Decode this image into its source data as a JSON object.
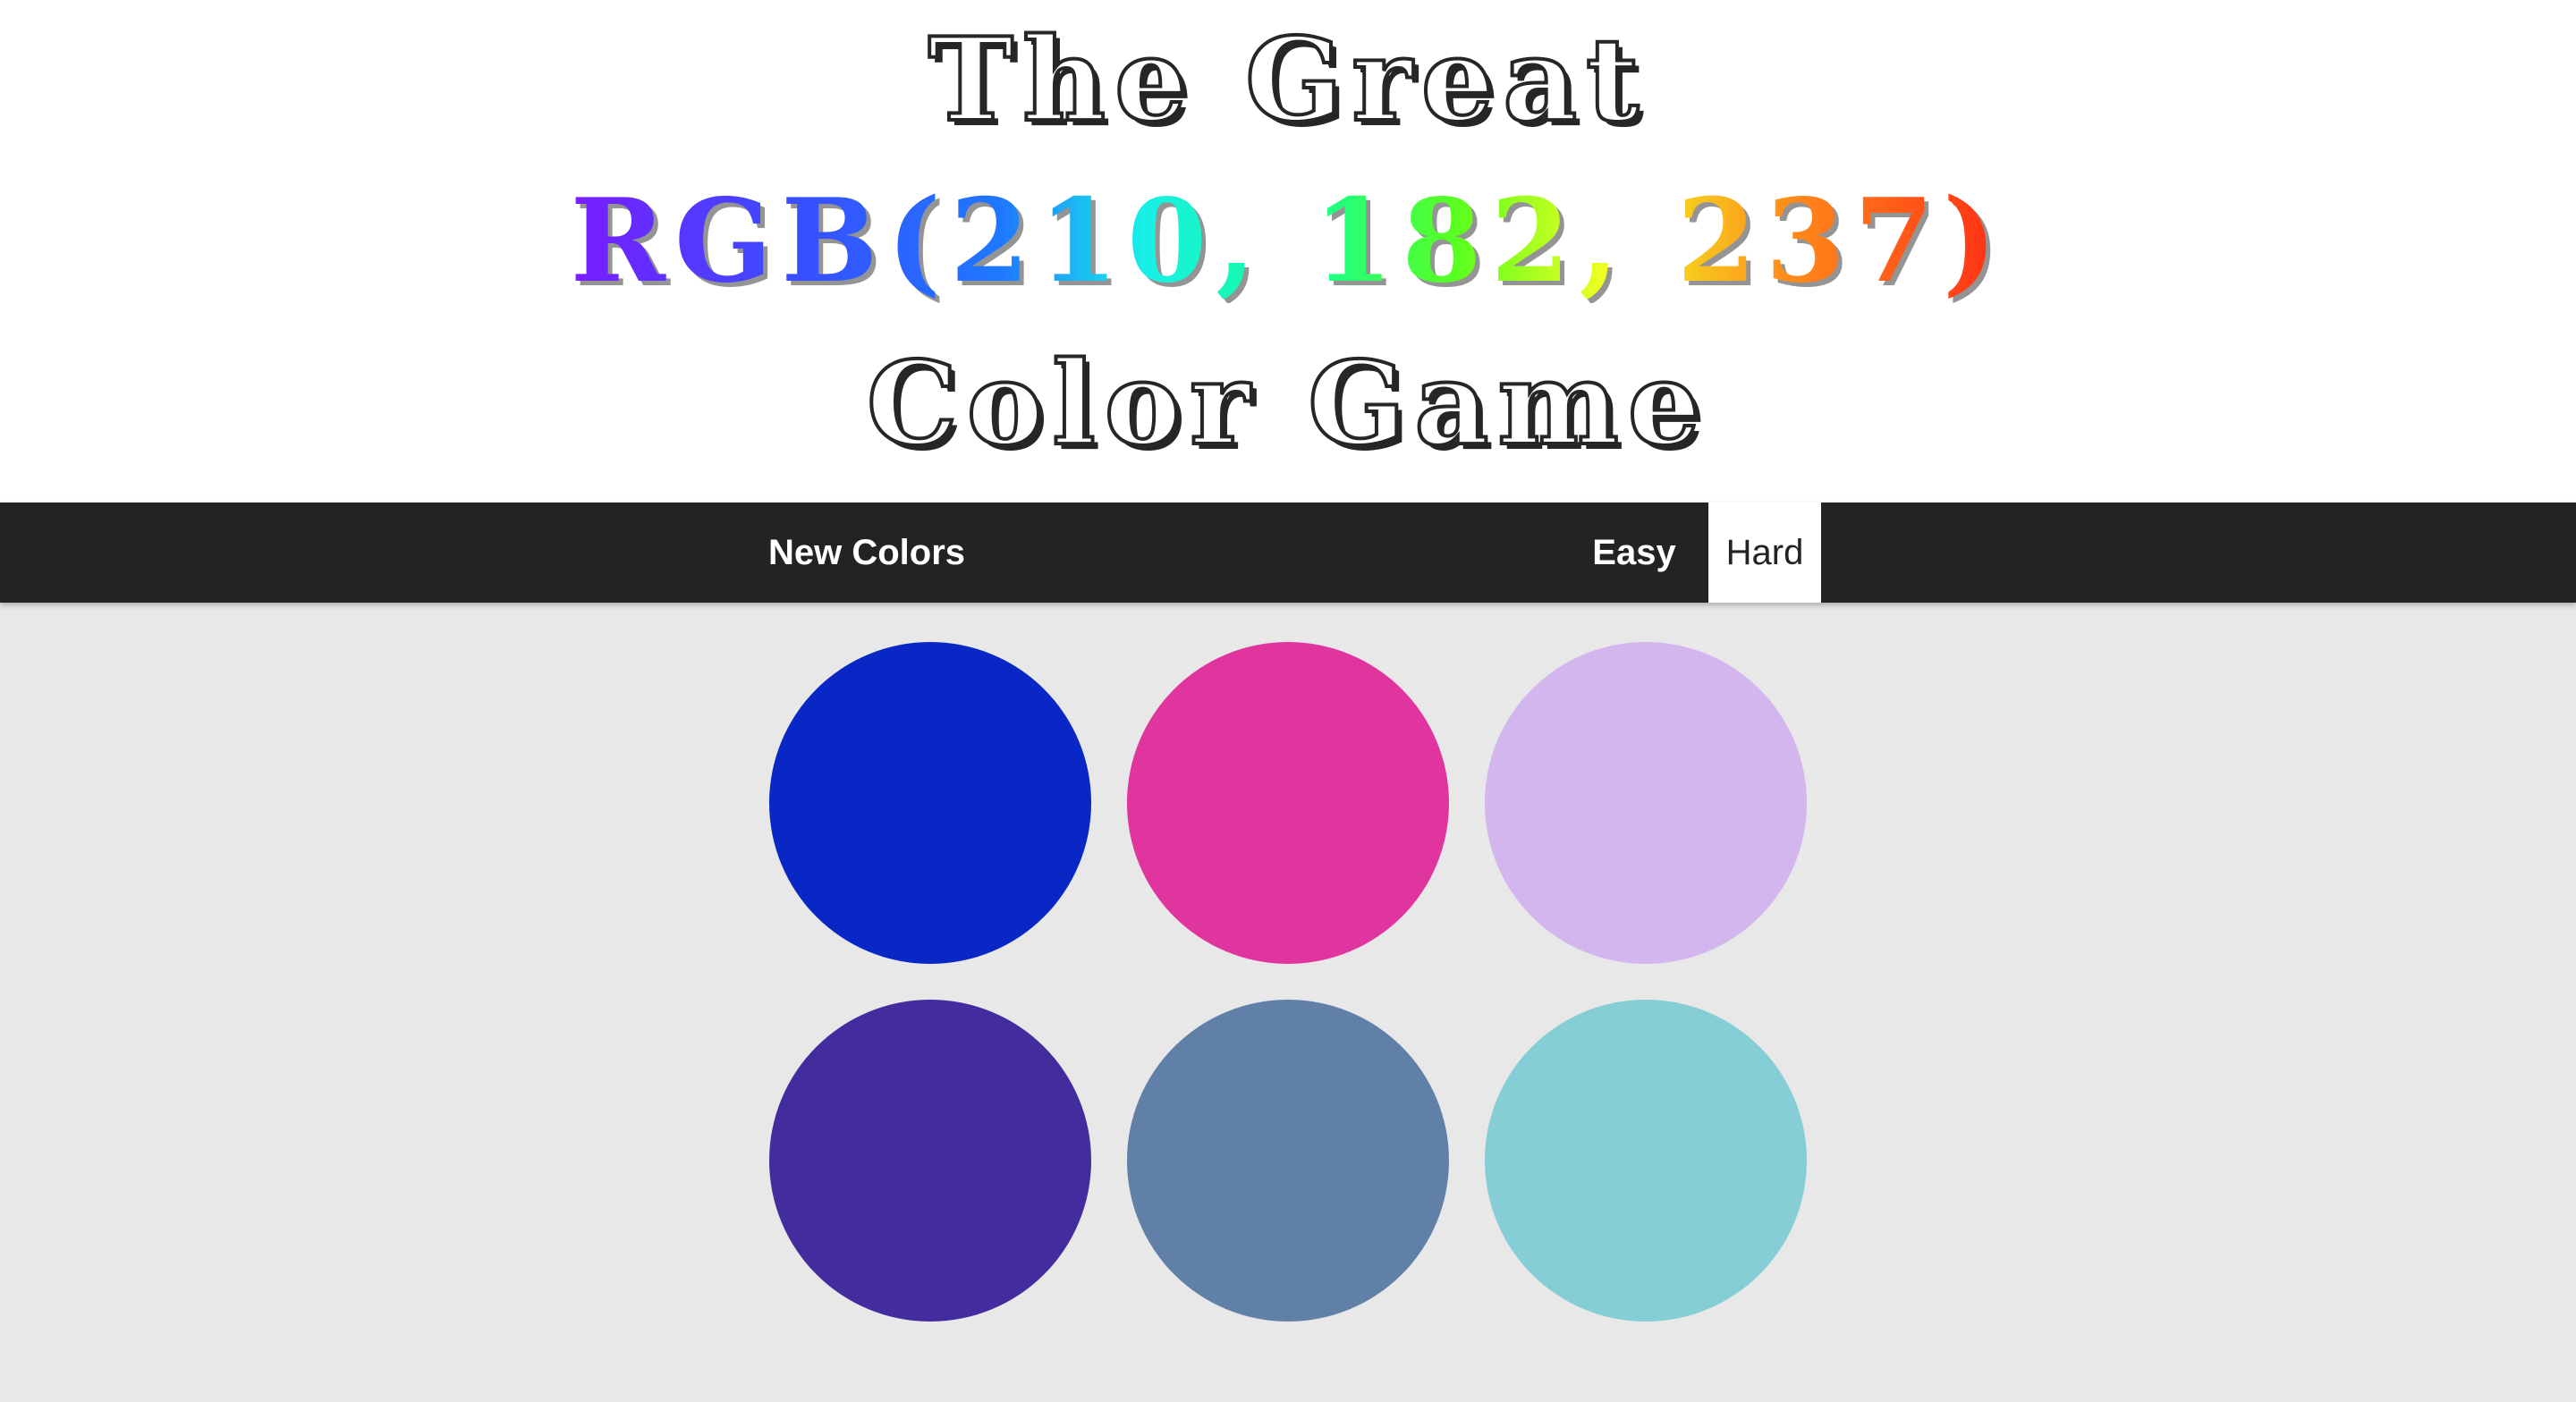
{
  "header": {
    "line1": "The Great",
    "target_color_label": "RGB(210, 182, 237)",
    "line3": "Color Game"
  },
  "controls": {
    "new_colors_label": "New Colors",
    "easy_label": "Easy",
    "hard_label": "Hard",
    "selected_mode": "Hard"
  },
  "colors": {
    "header_bg": "#ffffff",
    "stripe_bg": "#232323",
    "page_bg": "#e8e8e8"
  },
  "squares": [
    {
      "color": "#0827c4"
    },
    {
      "color": "#e0359e"
    },
    {
      "color": "#d2b6ed"
    },
    {
      "color": "#432c9e"
    },
    {
      "color": "#6180a8"
    },
    {
      "color": "#86ced6"
    }
  ]
}
